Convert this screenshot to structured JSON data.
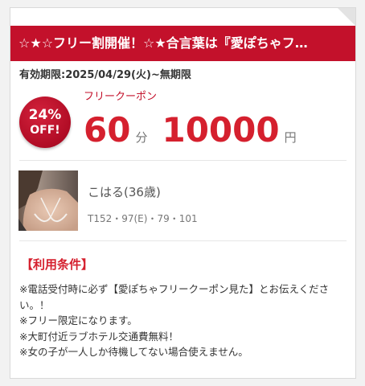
{
  "banner": {
    "title": "☆★☆フリー割開催！☆★合言葉は『愛ぽちゃフ…"
  },
  "validity": "有効期限:2025/04/29(火)~無期限",
  "coupon": {
    "discount_pct": "24%",
    "discount_off": "OFF!",
    "label": "フリークーポン",
    "minutes": "60",
    "minutes_unit": "分",
    "price": "10000",
    "price_unit": "円"
  },
  "girl": {
    "name": "こはる(36歳)",
    "stats": "T152・97(E)・79・101"
  },
  "conditions": {
    "title": "【利用条件】",
    "items": [
      "※電話受付時に必ず【愛ぽちゃフリークーポン見た】とお伝えください。！",
      "※フリー限定になります。",
      "※大町付近ラブホテル交通費無料！",
      "※女の子が一人しか待機してない場合使えません。"
    ]
  },
  "colors": {
    "brand_red": "#c3112b",
    "price_red": "#d5202e"
  }
}
